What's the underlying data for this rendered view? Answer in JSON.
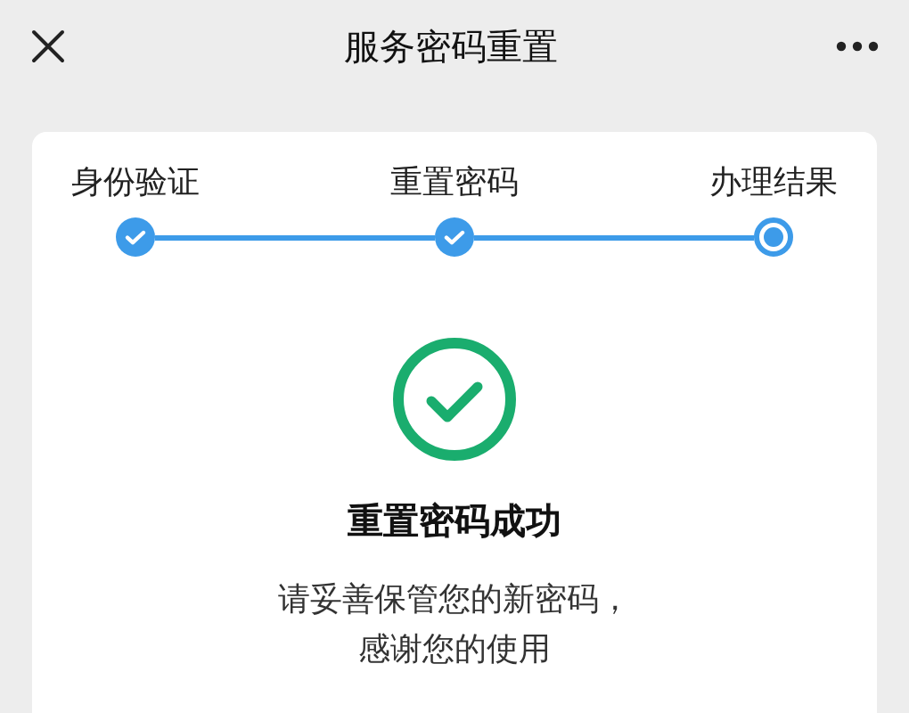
{
  "header": {
    "title": "服务密码重置"
  },
  "steps": [
    {
      "label": "身份验证",
      "kind": "done"
    },
    {
      "label": "重置密码",
      "kind": "done"
    },
    {
      "label": "办理结果",
      "kind": "current"
    }
  ],
  "result": {
    "title": "重置密码成功",
    "message_lines": [
      "请妥善保管您的新密码，",
      "感谢您的使用"
    ]
  }
}
